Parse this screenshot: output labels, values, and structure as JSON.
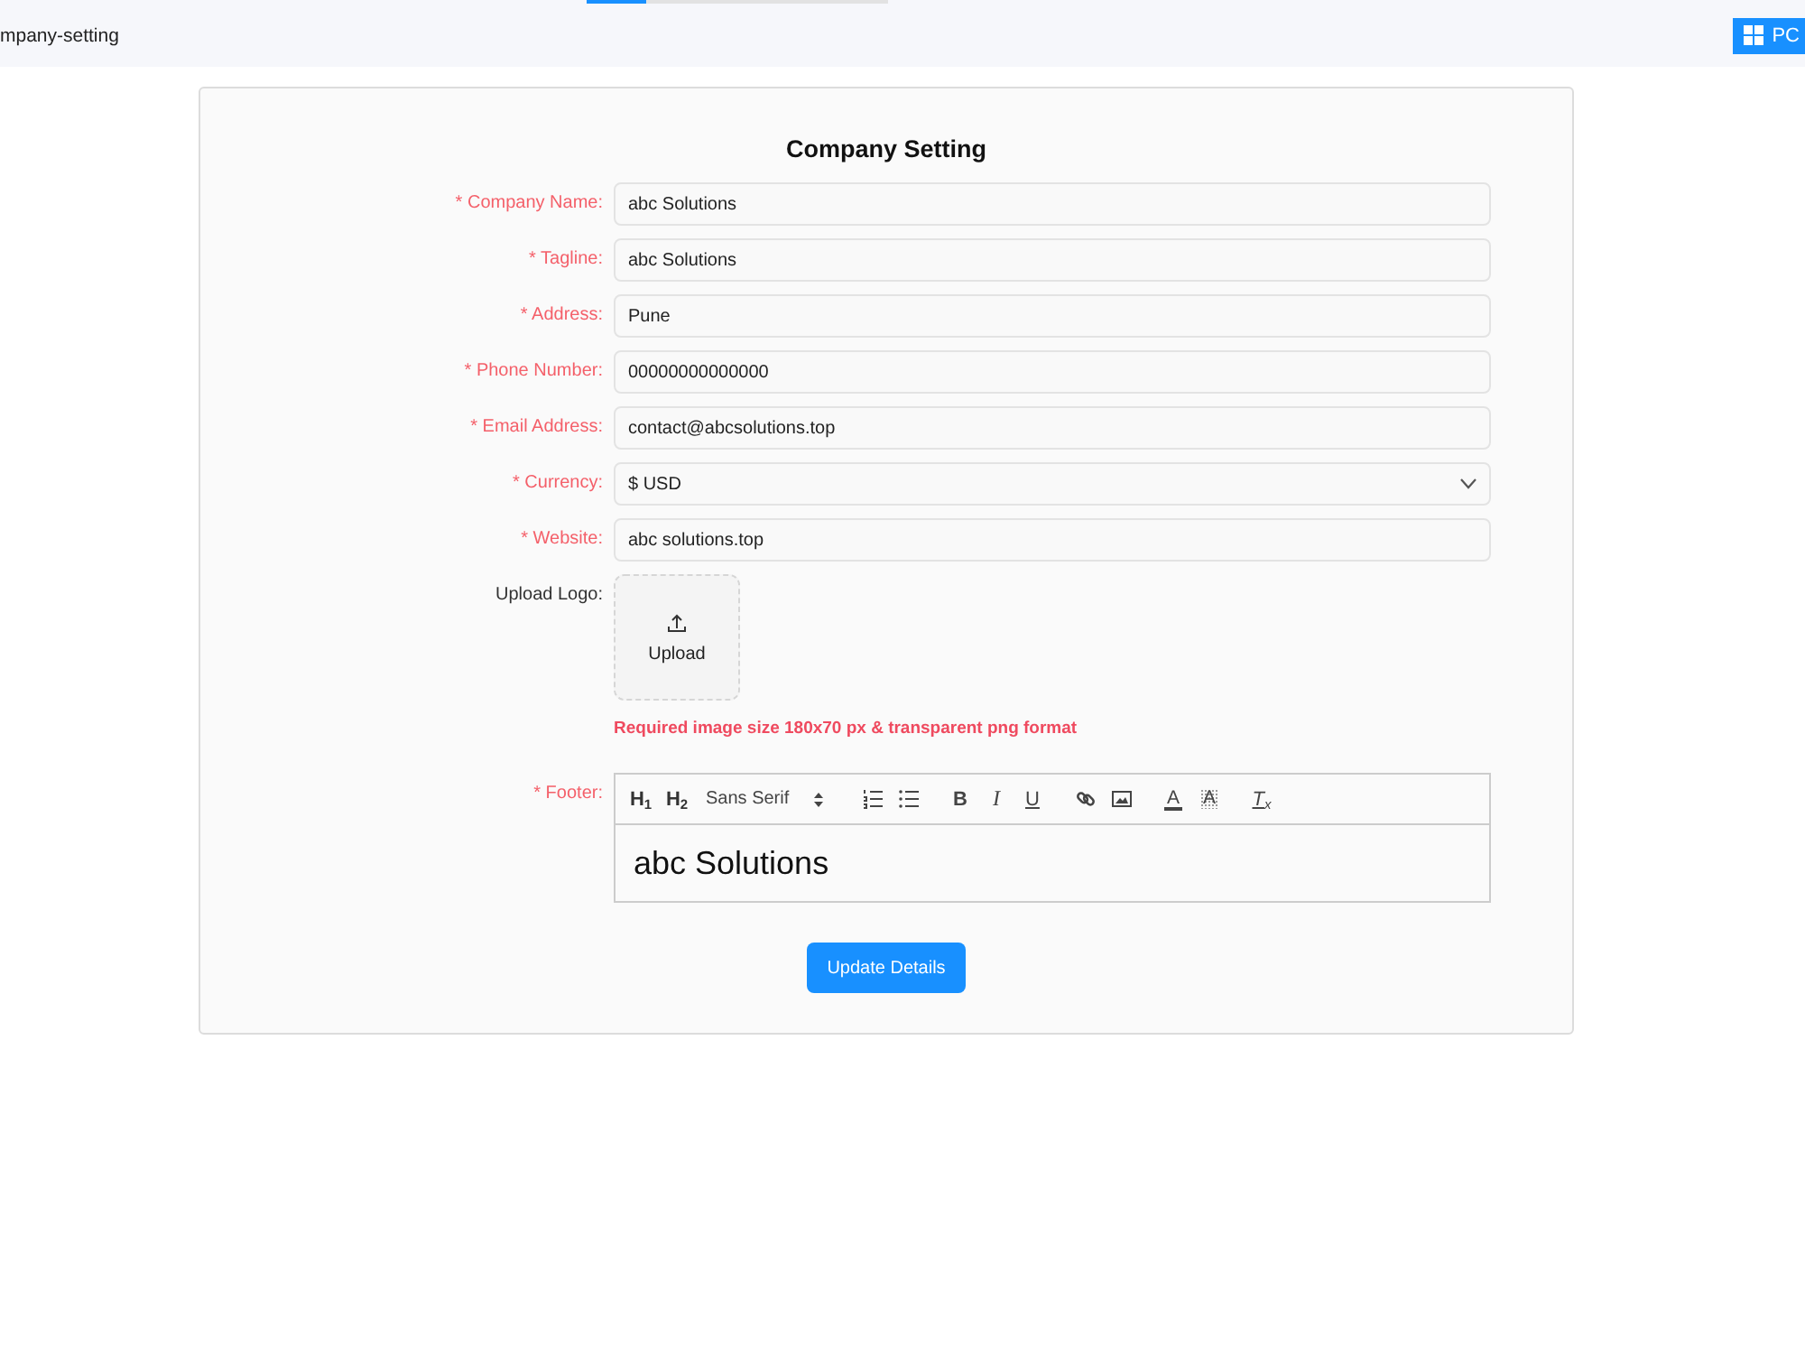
{
  "header": {
    "breadcrumb": "mpany-setting",
    "view_button": "PC"
  },
  "form": {
    "title": "Company Setting",
    "fields": [
      {
        "kind": "input",
        "label": "* Company Name:",
        "required": true,
        "value": "abc Solutions"
      },
      {
        "kind": "input",
        "label": "* Tagline:",
        "required": true,
        "value": "abc Solutions"
      },
      {
        "kind": "input",
        "label": "* Address:",
        "required": true,
        "value": "Pune"
      },
      {
        "kind": "input",
        "label": "* Phone Number:",
        "required": true,
        "value": "00000000000000"
      },
      {
        "kind": "input",
        "label": "* Email Address:",
        "required": true,
        "value": "contact@abcsolutions.top"
      },
      {
        "kind": "select",
        "label": "* Currency:",
        "required": true,
        "value": "$ USD"
      },
      {
        "kind": "input",
        "label": "* Website:",
        "required": true,
        "value": "abc solutions.top"
      }
    ],
    "logo": {
      "label": "Upload Logo:",
      "required": false,
      "button": "Upload",
      "hint": "Required image size 180x70 px & transparent png format"
    },
    "footer": {
      "label": "* Footer:",
      "required": true,
      "toolbar": [
        {
          "kind": "header",
          "label": "H$_{1}$"
        },
        {
          "kind": "header",
          "label": "H$_{2}$"
        },
        {
          "kind": "picker",
          "label": "Sans Serif"
        },
        {
          "kind": "ordered"
        },
        {
          "kind": "bullet"
        },
        {
          "kind": "bold",
          "label": "B"
        },
        {
          "kind": "italic",
          "label": "I"
        },
        {
          "kind": "underline",
          "label": "U"
        },
        {
          "kind": "link"
        },
        {
          "kind": "image"
        },
        {
          "kind": "color",
          "label": "A"
        },
        {
          "kind": "background",
          "label": "A"
        },
        {
          "kind": "clean",
          "label": "T$_{x}$"
        }
      ],
      "content": "abc Solutions"
    },
    "submit": "Update Details"
  }
}
